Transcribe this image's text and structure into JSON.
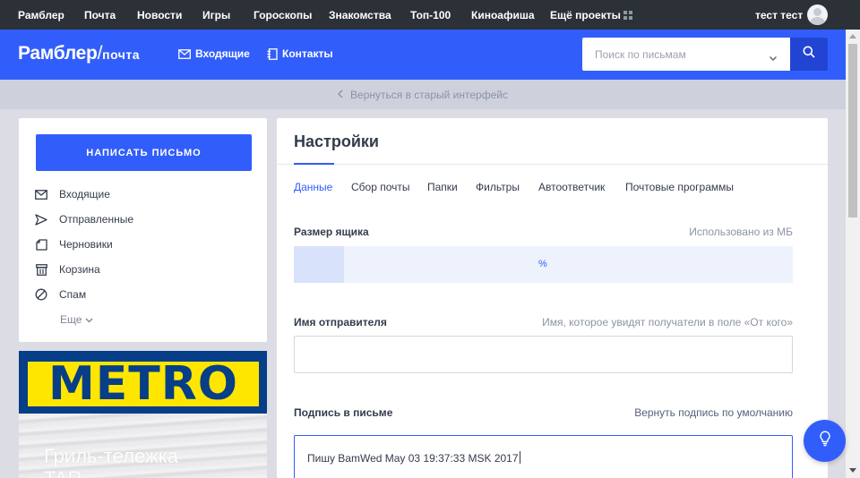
{
  "topnav": {
    "items": [
      "Рамблер",
      "Почта",
      "Новости",
      "Игры",
      "Гороскопы",
      "Знакомства",
      "Топ-100",
      "Киноафиша",
      "Ещё проекты"
    ],
    "user_name": "тест тест"
  },
  "header": {
    "logo_main": "Рамблер",
    "logo_slash": "/",
    "logo_sub": "почта",
    "inbox_link": "Входящие",
    "contacts_link": "Контакты",
    "search_placeholder": "Поиск по письмам"
  },
  "back_link": "Вернуться в старый интерфейс",
  "sidebar": {
    "compose_label": "НАПИСАТЬ ПИСЬМО",
    "folders": [
      {
        "label": "Входящие",
        "icon": "envelope-icon"
      },
      {
        "label": "Отправленные",
        "icon": "send-icon"
      },
      {
        "label": "Черновики",
        "icon": "draft-icon"
      },
      {
        "label": "Корзина",
        "icon": "trash-icon"
      },
      {
        "label": "Спам",
        "icon": "spam-icon"
      }
    ],
    "more_label": "Еще"
  },
  "ad": {
    "logo": "METRO",
    "text_line1": "Гриль-тележка",
    "text_line2": "TAR..."
  },
  "settings": {
    "title": "Настройки",
    "tabs": [
      "Данные",
      "Сбор почты",
      "Папки",
      "Фильтры",
      "Автоответчик",
      "Почтовые программы"
    ],
    "active_tab": "Данные",
    "mailbox_size_label": "Размер ящика",
    "mailbox_size_hint": "Использовано из МБ",
    "quota_percent_text": "%",
    "quota_fill_fraction": 0.1,
    "sender_name_label": "Имя отправителя",
    "sender_name_hint": "Имя, которое увидят получатели в поле «От кого»",
    "sender_name_value": "",
    "signature_label": "Подпись в письме",
    "signature_reset_link": "Вернуть подпись по умолчанию",
    "signature_value": "Пишу BamWed May 03 19:37:33 MSK 2017"
  },
  "colors": {
    "brand_blue": "#315efb",
    "topbar": "#2c3138",
    "page_bg": "#dcdde4"
  }
}
